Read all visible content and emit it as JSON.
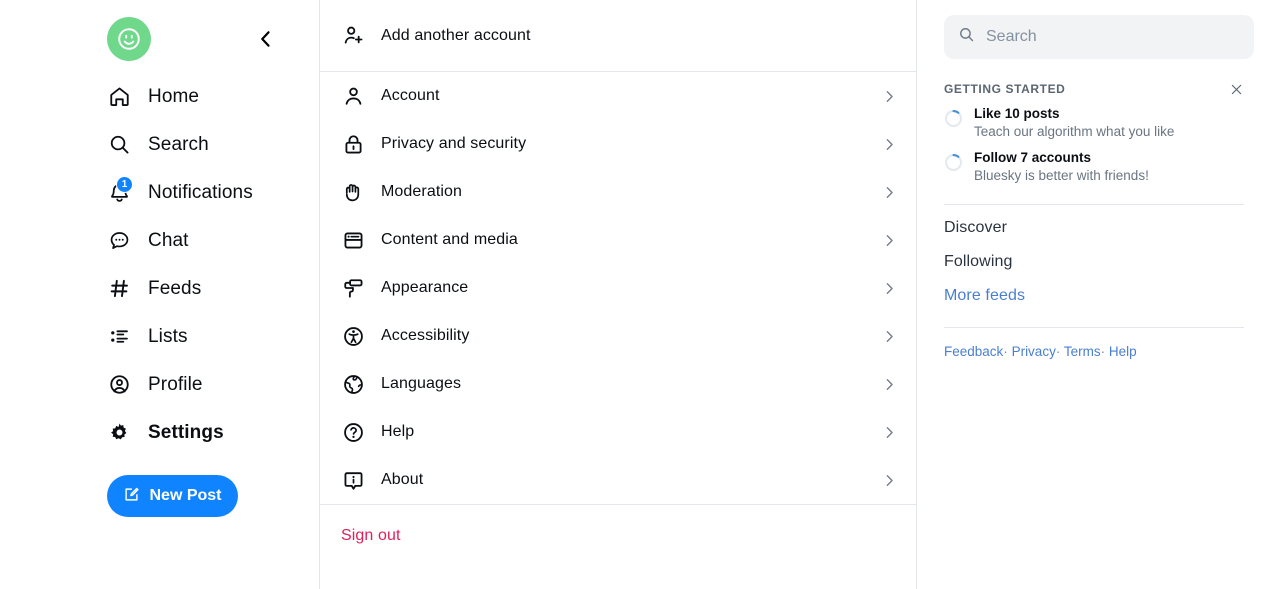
{
  "left_nav": {
    "avatar": {
      "icon": "smiley-avatar",
      "bg_color": "#6fd88b"
    },
    "back_button_icon": "chevron-left-icon",
    "items": [
      {
        "label": "Home",
        "icon": "home-icon",
        "active": false
      },
      {
        "label": "Search",
        "icon": "search-icon",
        "active": false
      },
      {
        "label": "Notifications",
        "icon": "bell-icon",
        "active": false,
        "badge": "1"
      },
      {
        "label": "Chat",
        "icon": "chat-bubble-icon",
        "active": false
      },
      {
        "label": "Feeds",
        "icon": "hash-icon",
        "active": false
      },
      {
        "label": "Lists",
        "icon": "list-icon",
        "active": false
      },
      {
        "label": "Profile",
        "icon": "user-circle-icon",
        "active": false
      },
      {
        "label": "Settings",
        "icon": "gear-icon",
        "active": true
      }
    ],
    "new_post": {
      "label": "New Post",
      "icon": "compose-icon",
      "color": "#1083fe"
    }
  },
  "settings": {
    "add_account": {
      "label": "Add another account",
      "icon": "user-plus-icon"
    },
    "items": [
      {
        "label": "Account",
        "icon": "user-icon"
      },
      {
        "label": "Privacy and security",
        "icon": "lock-icon"
      },
      {
        "label": "Moderation",
        "icon": "hand-icon"
      },
      {
        "label": "Content and media",
        "icon": "window-card-icon"
      },
      {
        "label": "Appearance",
        "icon": "paint-roller-icon"
      },
      {
        "label": "Accessibility",
        "icon": "accessibility-icon"
      },
      {
        "label": "Languages",
        "icon": "globe-icon"
      },
      {
        "label": "Help",
        "icon": "question-circle-icon"
      },
      {
        "label": "About",
        "icon": "info-callout-icon"
      }
    ],
    "chevron_icon": "chevron-right-icon",
    "sign_out": {
      "label": "Sign out",
      "color": "#e01e5a"
    }
  },
  "right_sidebar": {
    "search": {
      "placeholder": "Search",
      "value": "",
      "icon": "search-icon"
    },
    "getting_started": {
      "title": "GETTING STARTED",
      "close_icon": "close-icon",
      "tasks": [
        {
          "title": "Like 10 posts",
          "subtitle": "Teach our algorithm what you like",
          "progress": 0
        },
        {
          "title": "Follow 7 accounts",
          "subtitle": "Bluesky is better with friends!",
          "progress": 0
        }
      ]
    },
    "feeds": [
      {
        "label": "Discover",
        "style": "dark"
      },
      {
        "label": "Following",
        "style": "dark"
      },
      {
        "label": "More feeds",
        "style": "link"
      }
    ],
    "footer": {
      "links": [
        "Feedback",
        "Privacy",
        "Terms",
        "Help"
      ],
      "separator": "·"
    }
  }
}
